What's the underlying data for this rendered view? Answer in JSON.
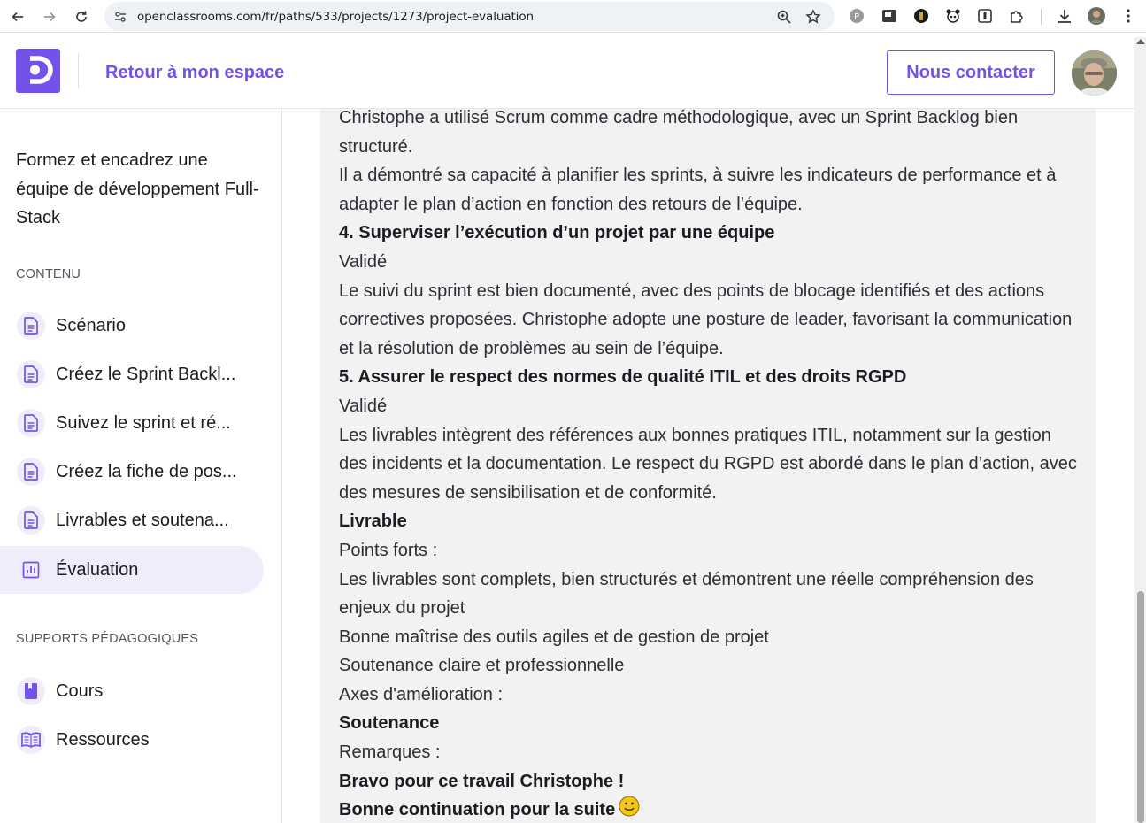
{
  "browser": {
    "url": "openclassrooms.com/fr/paths/533/projects/1273/project-evaluation"
  },
  "header": {
    "back_label": "Retour à mon espace",
    "contact_label": "Nous contacter"
  },
  "sidebar": {
    "course_title": "Formez et encadrez une équipe de développement Full-Stack",
    "content_heading": "CONTENU",
    "items": [
      {
        "label": "Scénario",
        "icon": "document-icon"
      },
      {
        "label": "Créez le Sprint Backl...",
        "icon": "document-icon"
      },
      {
        "label": "Suivez le sprint et ré...",
        "icon": "document-icon"
      },
      {
        "label": "Créez la fiche de pos...",
        "icon": "document-icon"
      },
      {
        "label": "Livrables et soutena...",
        "icon": "document-icon"
      },
      {
        "label": "Évaluation",
        "icon": "chart-icon",
        "active": true
      }
    ],
    "resources_heading": "SUPPORTS PÉDAGOGIQUES",
    "resources": [
      {
        "label": "Cours",
        "icon": "book-icon"
      },
      {
        "label": "Ressources",
        "icon": "open-book-icon"
      }
    ]
  },
  "main": {
    "lines": [
      {
        "text": "Christophe a utilisé Scrum comme cadre méthodologique, avec un Sprint Backlog bien structuré.",
        "bold": false
      },
      {
        "text": "Il a démontré sa capacité à planifier les sprints, à suivre les indicateurs de performance et à adapter le plan d’action en fonction des retours de l’équipe.",
        "bold": false
      },
      {
        "text": "4. Superviser l’exécution d’un projet par une équipe",
        "bold": true
      },
      {
        "text": "Validé",
        "bold": false
      },
      {
        "text": "Le suivi du sprint est bien documenté, avec des points de blocage identifiés et des actions correctives proposées. Christophe adopte une posture de leader, favorisant la communication et la résolution de problèmes au sein de l’équipe.",
        "bold": false
      },
      {
        "text": "5. Assurer le respect des normes de qualité ITIL et des droits RGPD",
        "bold": true
      },
      {
        "text": "Validé",
        "bold": false
      },
      {
        "text": "Les livrables intègrent des références aux bonnes pratiques ITIL, notamment sur la gestion des incidents et la documentation. Le respect du RGPD est abordé dans le plan d’action, avec des mesures de sensibilisation et de conformité.",
        "bold": false
      },
      {
        "text": "Livrable",
        "bold": true
      },
      {
        "text": "Points forts :",
        "bold": false
      },
      {
        "text": "Les livrables sont complets, bien structurés et démontrent une réelle compréhension des enjeux du projet",
        "bold": false
      },
      {
        "text": "Bonne maîtrise des outils agiles et de gestion de projet",
        "bold": false
      },
      {
        "text": "Soutenance claire et professionnelle",
        "bold": false
      },
      {
        "text": "Axes d'amélioration :",
        "bold": false
      },
      {
        "text": "Soutenance",
        "bold": true
      },
      {
        "text": "Remarques :",
        "bold": false
      },
      {
        "text": "Bravo pour ce travail  Christophe !",
        "bold": true
      },
      {
        "text": "Bonne continuation pour la suite",
        "bold": true,
        "emoji": "smiley-icon"
      }
    ]
  },
  "colors": {
    "brand": "#7451eb",
    "active_bg": "#efedfb",
    "panel_bg": "#f2f2f2"
  }
}
